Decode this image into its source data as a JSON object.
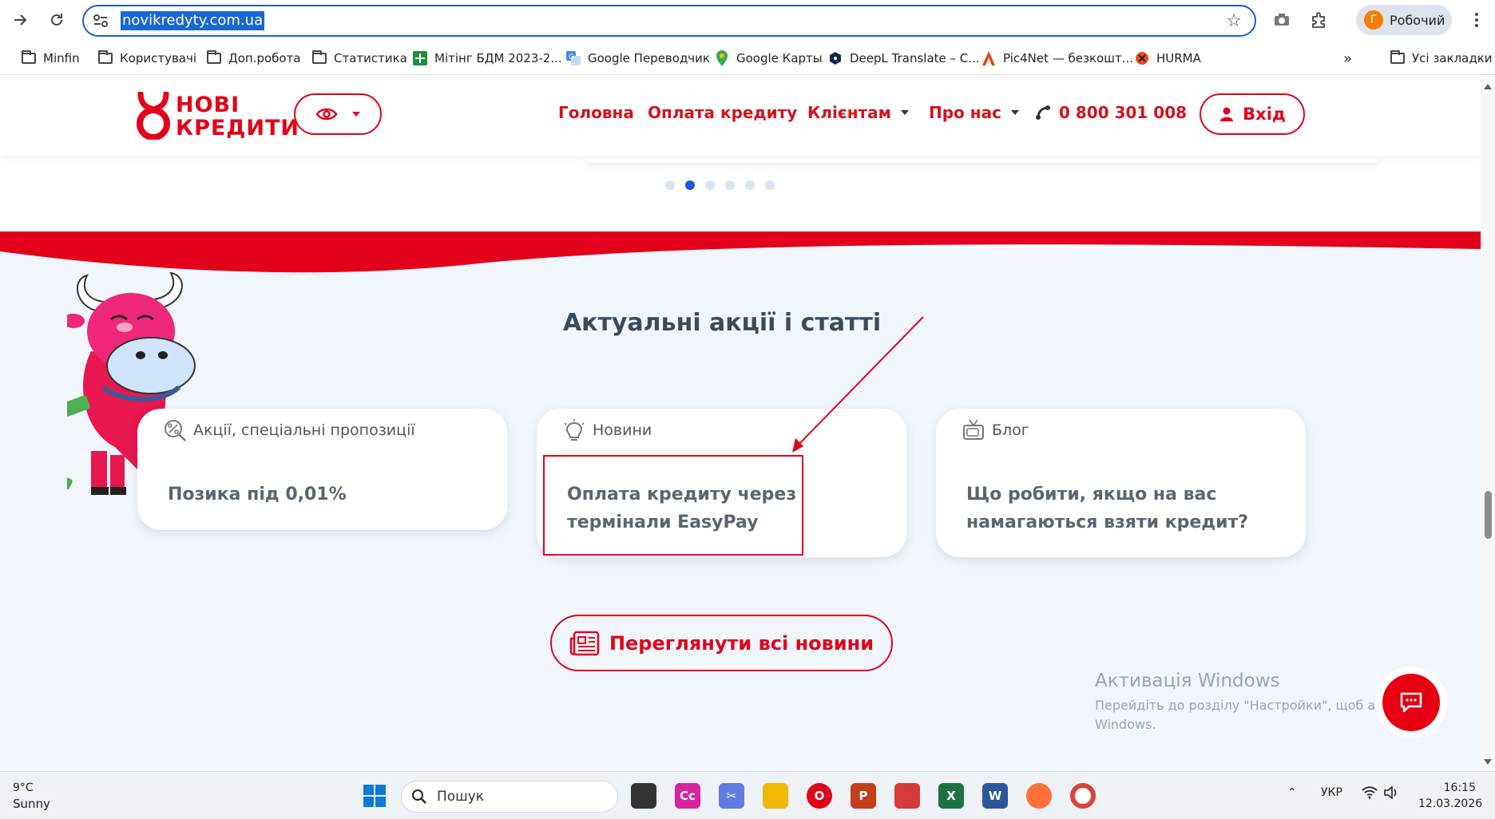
{
  "browser": {
    "url": "novikredyty.com.ua",
    "profile_initial": "Г",
    "profile_name": "Робочий",
    "bookmarks": [
      {
        "label": "Minfin",
        "icon": "folder-icon"
      },
      {
        "label": "Користувачі",
        "icon": "folder-icon"
      },
      {
        "label": "Доп.робота",
        "icon": "folder-icon"
      },
      {
        "label": "Статистика",
        "icon": "folder-icon"
      },
      {
        "label": "Мітінг БДМ 2023-2...",
        "icon": "sheets-icon"
      },
      {
        "label": "Google Переводчик",
        "icon": "translate-icon"
      },
      {
        "label": "Google Карты",
        "icon": "maps-icon"
      },
      {
        "label": "DeepL Translate – C...",
        "icon": "deepl-icon"
      },
      {
        "label": "Pic4Net — безкошт...",
        "icon": "pic4net-icon"
      },
      {
        "label": "HURMA",
        "icon": "hurma-icon"
      }
    ],
    "all_bookmarks": "Усі закладки",
    "overflow": "»"
  },
  "site": {
    "logo_line1": "НОВІ",
    "logo_line2": "КРЕДИТИ",
    "nav": {
      "home": "Головна",
      "payment": "Оплата кредиту",
      "clients": "Клієнтам",
      "about": "Про нас",
      "phone": "0 800 301 008"
    },
    "login": "Вхід",
    "slider": {
      "count": 6,
      "active": 1
    },
    "section_title": "Актуальні акції і статті",
    "cards": [
      {
        "category": "Акції, спеціальні пропозиції",
        "icon": "percent-icon",
        "text_line1": "Позика під 0,01%",
        "text_line2": ""
      },
      {
        "category": "Новини",
        "icon": "lightbulb-icon",
        "text_line1": "Оплата кредиту через",
        "text_line2": "термінали EasyPay"
      },
      {
        "category": "Блог",
        "icon": "tv-icon",
        "text_line1": "Що робити, якщо на вас",
        "text_line2": "намагаються взяти кредит?"
      }
    ],
    "all_news": "Переглянути всі новини",
    "activation_title": "Активація Windows",
    "activation_line1": "Перейдіть до розділу \"Настройки\", щоб активувати",
    "activation_line2": "Windows."
  },
  "colors": {
    "brand_red": "#e2001a",
    "nav_red": "#d3121c",
    "section_bg": "#f1f6fd",
    "dot_active": "#1e56d9",
    "title": "#3b4a5a"
  },
  "taskbar": {
    "temp": "9°C",
    "weather": "Sunny",
    "search": "Пошук",
    "lang": "УКР",
    "time": "16:15",
    "date": "12.03.2026"
  }
}
